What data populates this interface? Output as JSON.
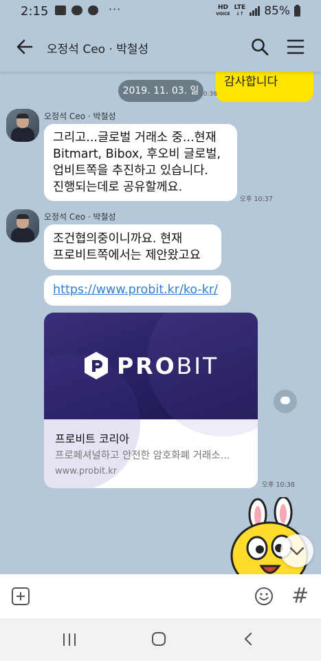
{
  "status_bar": {
    "time": "2:15",
    "dots": "···",
    "hd_label": "HD",
    "hd_sub": "VOICE",
    "lte_label": "LTE",
    "battery": "85%"
  },
  "header": {
    "title": "오정석 Ceo · 박철성"
  },
  "chat": {
    "previous_message": "감사합니다",
    "date_separator": "2019. 11. 03. 일",
    "partial_time": "10:36",
    "messages": [
      {
        "sender": "오정석 Ceo · 박철성",
        "lines": [
          "그리고...글로벌 거래소 중...현재",
          "Bitmart, Bibox, 후오비 글로벌,",
          "업비트쪽을 추진하고 있습니다.",
          "진행되는데로 공유할께요."
        ],
        "time": "오후 10:37"
      },
      {
        "sender": "오정석 Ceo · 박철성",
        "lines": [
          "조건협의중이니까요. 현재",
          "프로비트쪽에서는 제안왔고요"
        ],
        "link": "https://www.probit.kr/ko-kr/",
        "card": {
          "brand_bold": "PRO",
          "brand_light": "BIT",
          "title": "프로비트 코리아",
          "description": "프로페셔널하고 안전한 암호화폐 거래소...",
          "url": "www.probit.kr"
        },
        "time": "오후 10:38"
      }
    ]
  },
  "input": {
    "placeholder": "",
    "hash": "#"
  },
  "colors": {
    "chat_bg": "#b5c8da",
    "my_bubble": "#fee500",
    "link": "#2f7fd4",
    "card_banner": "#2a2366"
  }
}
